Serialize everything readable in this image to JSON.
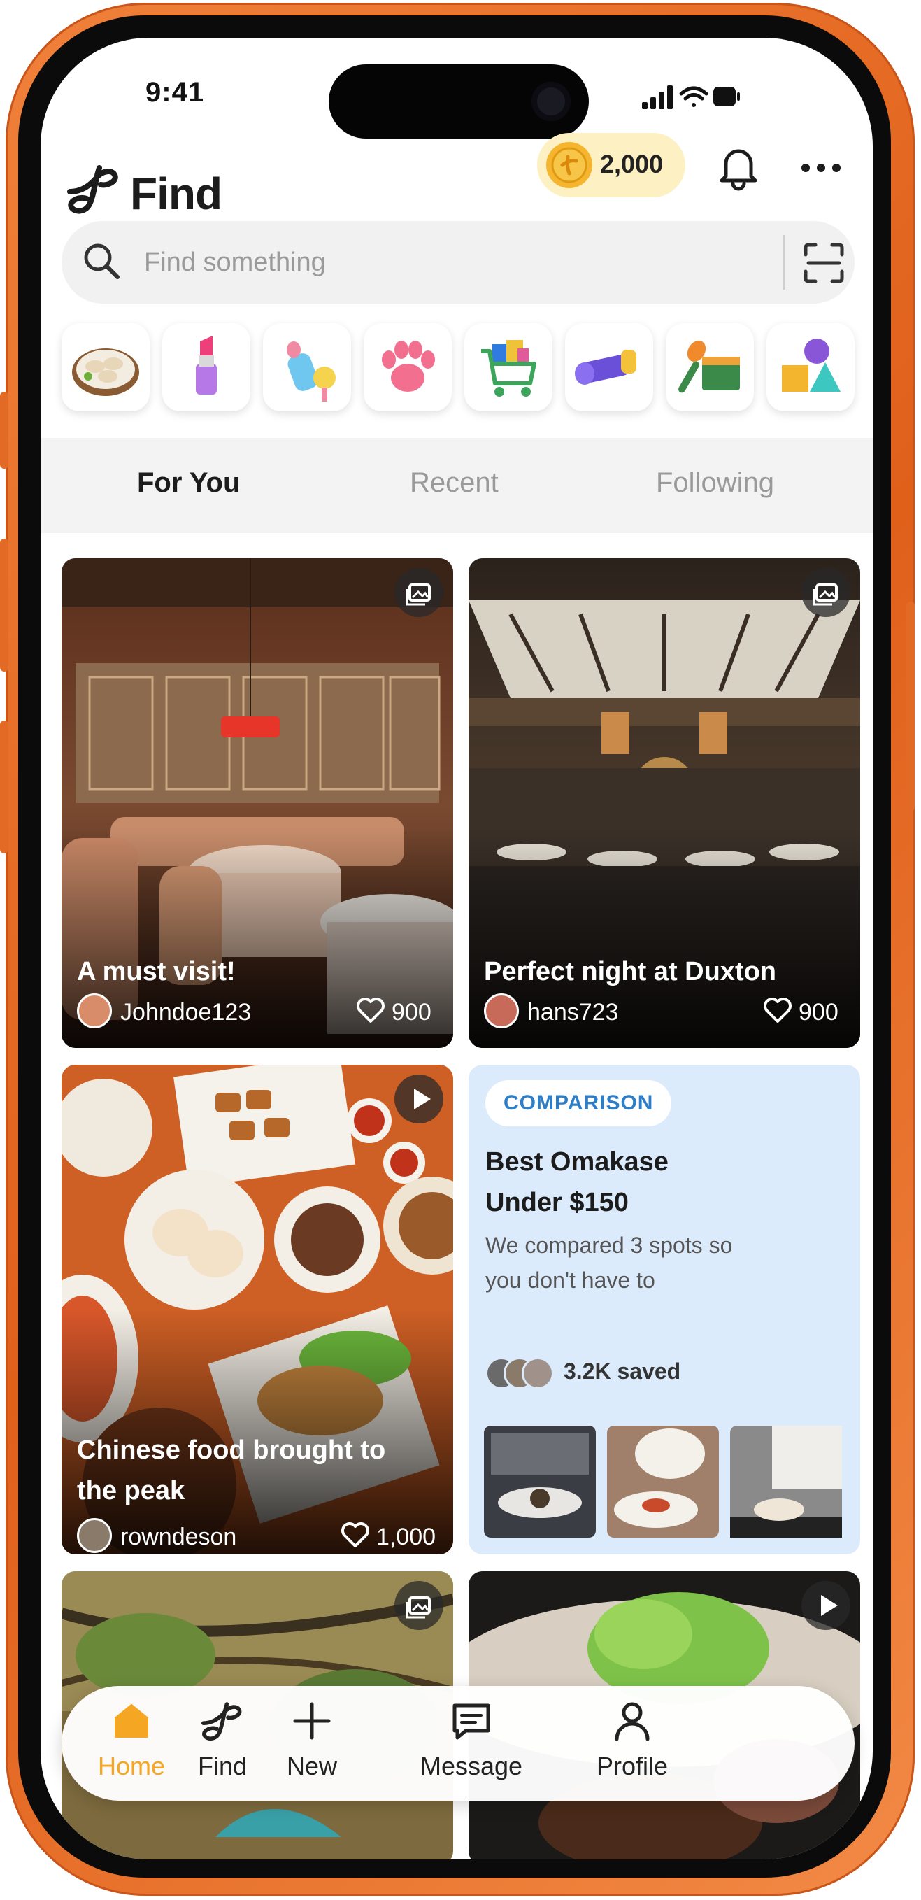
{
  "status_bar": {
    "time": "9:41"
  },
  "header": {
    "app_name": "Find",
    "coins": "2,000"
  },
  "search": {
    "placeholder": "Find something"
  },
  "categories": [
    {
      "icon": "dumplings-icon"
    },
    {
      "icon": "lipstick-icon"
    },
    {
      "icon": "baby-bottle-icon"
    },
    {
      "icon": "paw-icon"
    },
    {
      "icon": "shopping-cart-icon"
    },
    {
      "icon": "yoga-mat-icon"
    },
    {
      "icon": "microphone-clapper-icon"
    },
    {
      "icon": "shapes-icon"
    }
  ],
  "tabs": [
    {
      "label": "For You",
      "active": true
    },
    {
      "label": "Recent",
      "active": false
    },
    {
      "label": "Following",
      "active": false
    }
  ],
  "feed": {
    "card1": {
      "title": "A must visit!",
      "user": "Johndoe123",
      "likes": "900",
      "media": "gallery-icon"
    },
    "card2": {
      "title": "Perfect night at Duxton",
      "user": "hans723",
      "likes": "900",
      "media": "gallery-icon"
    },
    "card3": {
      "title_line1": "Chinese food brought to",
      "title_line2": "the peak",
      "user": "rowndeson",
      "likes": "1,000",
      "media": "play-icon"
    },
    "comparison": {
      "tag": "COMPARISON",
      "title_line1": "Best Omakase",
      "title_line2": "Under $150",
      "desc_line1": "We compared 3 spots so",
      "desc_line2": "you don't have to",
      "saved": "3.2K saved"
    }
  },
  "nav": [
    {
      "label": "Home",
      "icon": "home-icon",
      "active": true
    },
    {
      "label": "Find",
      "icon": "find-logo-icon",
      "active": false
    },
    {
      "label": "New",
      "icon": "plus-icon",
      "active": false
    },
    {
      "label": "Message",
      "icon": "message-icon",
      "active": false
    },
    {
      "label": "Profile",
      "icon": "profile-icon",
      "active": false
    }
  ],
  "colors": {
    "accent": "#f5a623",
    "frame": "#ec6f27",
    "tag_blue": "#2d7ec9",
    "comparison_bg": "#dcebfb"
  }
}
